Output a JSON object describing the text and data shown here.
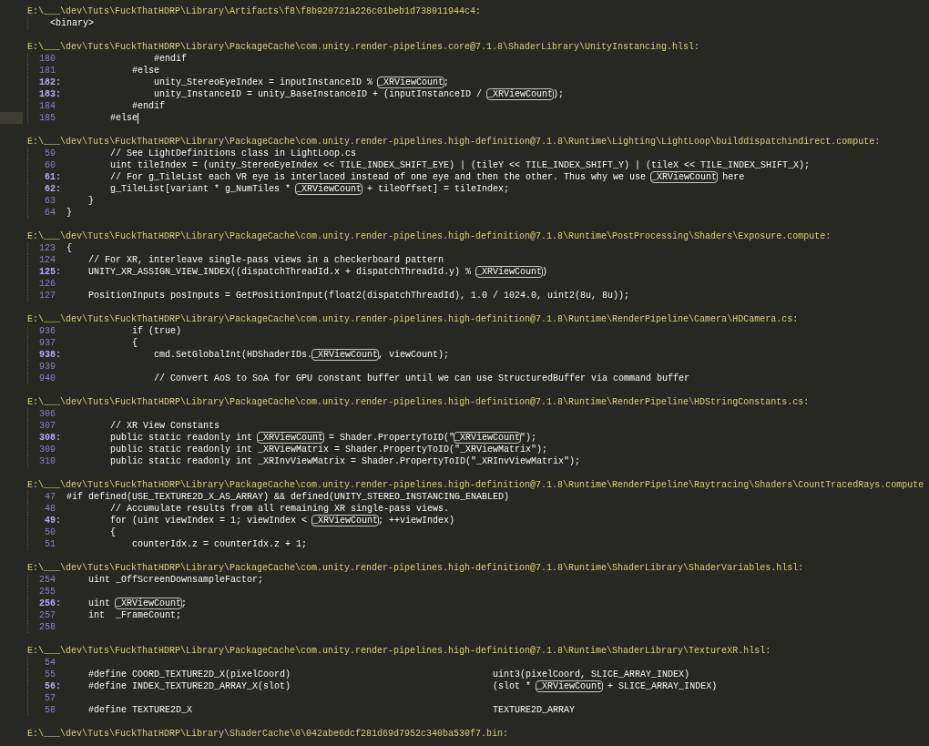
{
  "results": [
    {
      "path": "E:\\___\\dev\\Tuts\\FuckThatHDRP\\Library\\Artifacts\\f8\\f8b920721a226c01beb1d738011944c4:",
      "note": "<binary>"
    },
    {
      "path": "E:\\___\\dev\\Tuts\\FuckThatHDRP\\Library\\PackageCache\\com.unity.render-pipelines.core@7.1.8\\ShaderLibrary\\UnityInstancing.hlsl:",
      "lines": [
        {
          "number": "180",
          "matched": false,
          "current": false,
          "code": [
            "                #endif"
          ]
        },
        {
          "number": "181",
          "matched": false,
          "current": false,
          "code": [
            "            #else"
          ]
        },
        {
          "number": "182:",
          "matched": true,
          "current": false,
          "code": [
            "                unity_StereoEyeIndex = inputInstanceID % ",
            "_XRViewCount",
            ";"
          ]
        },
        {
          "number": "183:",
          "matched": true,
          "current": false,
          "code": [
            "                unity_InstanceID = unity_BaseInstanceID + (inputInstanceID / ",
            "_XRViewCount",
            ");"
          ]
        },
        {
          "number": "184",
          "matched": false,
          "current": false,
          "code": [
            "            #endif"
          ]
        },
        {
          "number": "185",
          "matched": false,
          "current": true,
          "code": [
            "        #else"
          ]
        }
      ]
    },
    {
      "path": "E:\\___\\dev\\Tuts\\FuckThatHDRP\\Library\\PackageCache\\com.unity.render-pipelines.high-definition@7.1.8\\Runtime\\Lighting\\LightLoop\\builddispatchindirect.compute:",
      "lines": [
        {
          "number": "59",
          "matched": false,
          "current": false,
          "code": [
            "        // See LightDefinitions class in LightLoop.cs"
          ]
        },
        {
          "number": "60",
          "matched": false,
          "current": false,
          "code": [
            "        uint tileIndex = (unity_StereoEyeIndex << TILE_INDEX_SHIFT_EYE) | (tileY << TILE_INDEX_SHIFT_Y) | (tileX << TILE_INDEX_SHIFT_X);"
          ]
        },
        {
          "number": "61:",
          "matched": true,
          "current": false,
          "code": [
            "        // For g_TileList each VR eye is interlaced instead of one eye and then the other. Thus why we use ",
            "_XRViewCount",
            " here"
          ]
        },
        {
          "number": "62:",
          "matched": true,
          "current": false,
          "code": [
            "        g_TileList[variant * g_NumTiles * ",
            "_XRViewCount",
            " + tileOffset] = tileIndex;"
          ]
        },
        {
          "number": "63",
          "matched": false,
          "current": false,
          "code": [
            "    }"
          ]
        },
        {
          "number": "64",
          "matched": false,
          "current": false,
          "code": [
            "}"
          ]
        }
      ]
    },
    {
      "path": "E:\\___\\dev\\Tuts\\FuckThatHDRP\\Library\\PackageCache\\com.unity.render-pipelines.high-definition@7.1.8\\Runtime\\PostProcessing\\Shaders\\Exposure.compute:",
      "lines": [
        {
          "number": "123",
          "matched": false,
          "current": false,
          "code": [
            "{"
          ]
        },
        {
          "number": "124",
          "matched": false,
          "current": false,
          "code": [
            "    // For XR, interleave single-pass views in a checkerboard pattern"
          ]
        },
        {
          "number": "125:",
          "matched": true,
          "current": false,
          "code": [
            "    UNITY_XR_ASSIGN_VIEW_INDEX((dispatchThreadId.x + dispatchThreadId.y) % ",
            "_XRViewCount",
            ")"
          ]
        },
        {
          "number": "126",
          "matched": false,
          "current": false
        },
        {
          "number": "127",
          "matched": false,
          "current": false,
          "code": [
            "    PositionInputs posInputs = GetPositionInput(float2(dispatchThreadId), 1.0 / 1024.0, uint2(8u, 8u));"
          ]
        }
      ]
    },
    {
      "path": "E:\\___\\dev\\Tuts\\FuckThatHDRP\\Library\\PackageCache\\com.unity.render-pipelines.high-definition@7.1.8\\Runtime\\RenderPipeline\\Camera\\HDCamera.cs:",
      "lines": [
        {
          "number": "936",
          "matched": false,
          "current": false,
          "code": [
            "            if (true)"
          ]
        },
        {
          "number": "937",
          "matched": false,
          "current": false,
          "code": [
            "            {"
          ]
        },
        {
          "number": "938:",
          "matched": true,
          "current": false,
          "code": [
            "                cmd.SetGlobalInt(HDShaderIDs.",
            "_XRViewCount",
            ", viewCount);"
          ]
        },
        {
          "number": "939",
          "matched": false,
          "current": false
        },
        {
          "number": "940",
          "matched": false,
          "current": false,
          "code": [
            "                // Convert AoS to SoA for GPU constant buffer until we can use StructuredBuffer via command buffer"
          ]
        }
      ]
    },
    {
      "path": "E:\\___\\dev\\Tuts\\FuckThatHDRP\\Library\\PackageCache\\com.unity.render-pipelines.high-definition@7.1.8\\Runtime\\RenderPipeline\\HDStringConstants.cs:",
      "lines": [
        {
          "number": "306",
          "matched": false,
          "current": false
        },
        {
          "number": "307",
          "matched": false,
          "current": false,
          "code": [
            "        // XR View Constants"
          ]
        },
        {
          "number": "308:",
          "matched": true,
          "current": false,
          "code": [
            "        public static readonly int ",
            "_XRViewCount",
            " = Shader.PropertyToID(\"",
            "_XRViewCount",
            "\");"
          ]
        },
        {
          "number": "309",
          "matched": false,
          "current": false,
          "code": [
            "        public static readonly int _XRViewMatrix = Shader.PropertyToID(\"_XRViewMatrix\");"
          ]
        },
        {
          "number": "310",
          "matched": false,
          "current": false,
          "code": [
            "        public static readonly int _XRInvViewMatrix = Shader.PropertyToID(\"_XRInvViewMatrix\");"
          ]
        }
      ]
    },
    {
      "path": "E:\\___\\dev\\Tuts\\FuckThatHDRP\\Library\\PackageCache\\com.unity.render-pipelines.high-definition@7.1.8\\Runtime\\RenderPipeline\\Raytracing\\Shaders\\CountTracedRays.compute",
      "lines": [
        {
          "number": "47",
          "matched": false,
          "current": false,
          "code": [
            "#if defined(USE_TEXTURE2D_X_AS_ARRAY) && defined(UNITY_STEREO_INSTANCING_ENABLED)"
          ]
        },
        {
          "number": "48",
          "matched": false,
          "current": false,
          "code": [
            "        // Accumulate results from all remaining XR single-pass views."
          ]
        },
        {
          "number": "49:",
          "matched": true,
          "current": false,
          "code": [
            "        for (uint viewIndex = 1; viewIndex < ",
            "_XRViewCount",
            "; ++viewIndex)"
          ]
        },
        {
          "number": "50",
          "matched": false,
          "current": false,
          "code": [
            "        {"
          ]
        },
        {
          "number": "51",
          "matched": false,
          "current": false,
          "code": [
            "            counterIdx.z = counterIdx.z + 1;"
          ]
        }
      ]
    },
    {
      "path": "E:\\___\\dev\\Tuts\\FuckThatHDRP\\Library\\PackageCache\\com.unity.render-pipelines.high-definition@7.1.8\\Runtime\\ShaderLibrary\\ShaderVariables.hlsl:",
      "lines": [
        {
          "number": "254",
          "matched": false,
          "current": false,
          "code": [
            "    uint _OffScreenDownsampleFactor;"
          ]
        },
        {
          "number": "255",
          "matched": false,
          "current": false
        },
        {
          "number": "256:",
          "matched": true,
          "current": false,
          "code": [
            "    uint ",
            "_XRViewCount",
            ";"
          ]
        },
        {
          "number": "257",
          "matched": false,
          "current": false,
          "code": [
            "    int  _FrameCount;"
          ]
        },
        {
          "number": "258",
          "matched": false,
          "current": false
        }
      ]
    },
    {
      "path": "E:\\___\\dev\\Tuts\\FuckThatHDRP\\Library\\PackageCache\\com.unity.render-pipelines.high-definition@7.1.8\\Runtime\\ShaderLibrary\\TextureXR.hlsl:",
      "lines": [
        {
          "number": "54",
          "matched": false,
          "current": false
        },
        {
          "number": "55",
          "matched": false,
          "current": false,
          "code": [
            "    #define COORD_TEXTURE2D_X(pixelCoord)                                     uint3(pixelCoord, SLICE_ARRAY_INDEX)"
          ]
        },
        {
          "number": "56:",
          "matched": true,
          "current": false,
          "code": [
            "    #define INDEX_TEXTURE2D_ARRAY_X(slot)                                     (slot * ",
            "_XRViewCount",
            " + SLICE_ARRAY_INDEX)"
          ]
        },
        {
          "number": "57",
          "matched": false,
          "current": false
        },
        {
          "number": "58",
          "matched": false,
          "current": false,
          "code": [
            "    #define TEXTURE2D_X                                                       TEXTURE2D_ARRAY"
          ]
        }
      ]
    },
    {
      "path": "E:\\___\\dev\\Tuts\\FuckThatHDRP\\Library\\ShaderCache\\0\\042abe6dcf281d69d7952c340ba530f7.bin:"
    }
  ]
}
